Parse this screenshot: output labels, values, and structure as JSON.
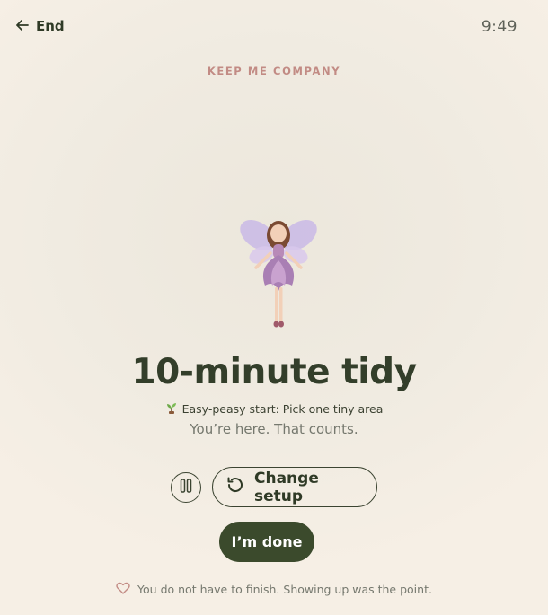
{
  "header": {
    "end_label": "End",
    "clock": "9:49"
  },
  "eyebrow": "KEEP ME COMPANY",
  "title": "10-minute tidy",
  "tip": "Easy-peasy start: Pick one tiny area",
  "subtitle": "You’re here. That counts.",
  "controls": {
    "change_setup_label": "Change setup",
    "done_label": "I’m done"
  },
  "footer": "You do not have to finish. Showing up was the point.",
  "colors": {
    "accent_dark": "#3b4a2c",
    "eyebrow": "#c28b84",
    "heart": "#c28b84"
  },
  "icons": [
    "arrow-left-icon",
    "fairy-illustration",
    "sprout-icon",
    "pause-icon",
    "refresh-icon",
    "heart-icon"
  ]
}
